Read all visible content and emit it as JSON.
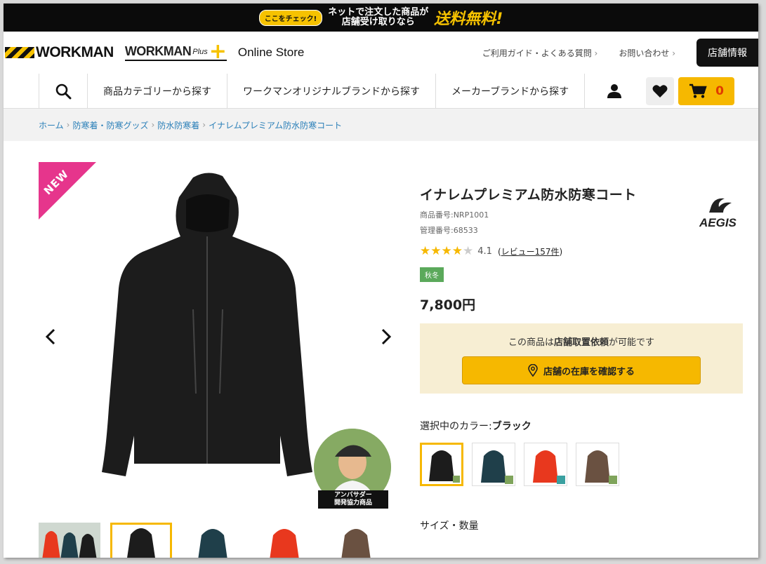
{
  "promo": {
    "badge": "ここをチェック!",
    "line1": "ネットで注文した商品が",
    "line2": "店舗受け取りなら",
    "free": "送料無料!"
  },
  "header": {
    "logo_workman": "WORKMAN",
    "logo_plus_main": "WORKMAN",
    "logo_plus_small": "Plus",
    "logo_plus_cross": "+",
    "online_store": "Online Store",
    "guide_link": "ご利用ガイド・よくある質問",
    "contact_link": "お問い合わせ",
    "store_info_button": "店舗情報"
  },
  "nav": {
    "category": "商品カテゴリーから探す",
    "original_brand": "ワークマンオリジナルブランドから探す",
    "maker_brand": "メーカーブランドから探す",
    "cart_count": "0"
  },
  "breadcrumb": [
    "ホーム",
    "防寒着・防寒グッズ",
    "防水防寒着",
    "イナレムプレミアム防水防寒コート"
  ],
  "gallery": {
    "new_badge": "NEW",
    "ambassador_line1": "アンバサダー",
    "ambassador_line2": "開発協力商品"
  },
  "product": {
    "title": "イナレムプレミアム防水防寒コート",
    "item_number": "商品番号:NRP1001",
    "manage_number": "管理番号:68533",
    "brand_logo_text": "AEGIS",
    "rating": 4.1,
    "rating_text": "4.1",
    "review_open": "(",
    "review_link": "レビュー157件",
    "review_close": ")",
    "season": "秋冬",
    "price": "7,800円",
    "store_box_pre": "この商品は",
    "store_box_bold": "店舗取置依頼",
    "store_box_post": "が可能です",
    "stock_button": "店舗の在庫を確認する",
    "color_label": "選択中のカラー:",
    "color_selected": "ブラック",
    "size_label": "サイズ・数量"
  },
  "colors": {
    "black": "#1c1c1c",
    "teal": "#1f3f4a",
    "red": "#e8381e",
    "brown": "#6a5141",
    "accent": "#f6b800",
    "new_pink": "#e6358c",
    "link": "#2a7fb8"
  },
  "icons": {
    "search": "search-icon",
    "user": "user-icon",
    "heart": "heart-icon",
    "cart": "cart-icon",
    "pin": "map-pin-icon",
    "prev": "chevron-left-icon",
    "next": "chevron-right-icon"
  }
}
